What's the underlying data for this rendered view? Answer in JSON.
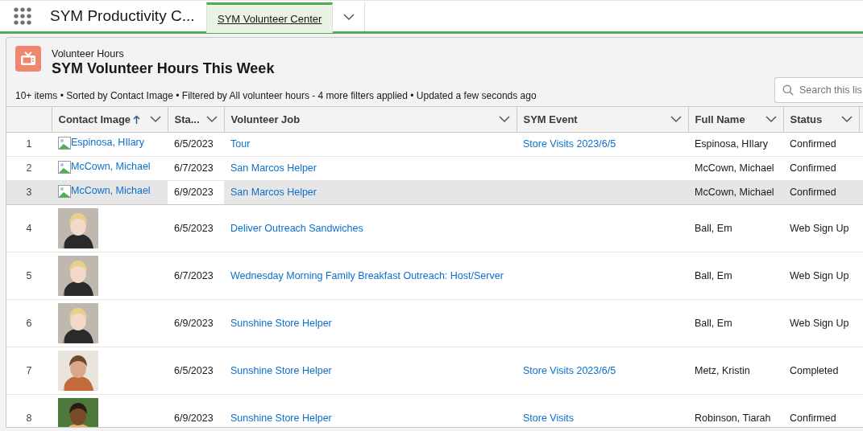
{
  "app": {
    "name": "SYM Productivity C..."
  },
  "tabs": [
    {
      "label": "SYM Volunteer Center",
      "selected": true
    }
  ],
  "list": {
    "object": "Volunteer Hours",
    "title": "SYM Volunteer Hours This Week",
    "info": "10+ items • Sorted by Contact Image • Filtered by All volunteer hours - 4 more filters applied • Updated a few seconds ago",
    "search": {
      "placeholder": "Search this lis"
    }
  },
  "columns": [
    {
      "label": "Contact Image",
      "sorted": true
    },
    {
      "label": "Sta...",
      "sorted": false
    },
    {
      "label": "Volunteer Job",
      "sorted": false
    },
    {
      "label": "SYM Event",
      "sorted": false
    },
    {
      "label": "Full Name",
      "sorted": false
    },
    {
      "label": "Status",
      "sorted": false
    }
  ],
  "rows": [
    {
      "number": "1",
      "contact": {
        "kind": "broken",
        "text": "Espinosa, HIlary"
      },
      "start": "6/5/2023",
      "job": "Tour",
      "event": "Store Visits 2023/6/5",
      "full_name": "Espinosa, HIlary",
      "status": "Confirmed",
      "selected": false
    },
    {
      "number": "2",
      "contact": {
        "kind": "broken",
        "text": "McCown, Michael"
      },
      "start": "6/7/2023",
      "job": "San Marcos Helper",
      "full_name": "McCown, Michael",
      "status": "Confirmed",
      "selected": false
    },
    {
      "number": "3",
      "contact": {
        "kind": "broken",
        "text": "McCown, Michael"
      },
      "start": "6/9/2023",
      "job": "San Marcos Helper",
      "full_name": "McCown, Michael",
      "status": "Confirmed",
      "selected": true
    },
    {
      "number": "4",
      "start": "6/5/2023",
      "job": "Deliver Outreach Sandwiches",
      "full_name": "Ball, Em",
      "status": "Web Sign Up",
      "selected": false
    },
    {
      "number": "5",
      "start": "6/7/2023",
      "job": "Wednesday Morning Family Breakfast Outreach: Host/Server",
      "full_name": "Ball, Em",
      "status": "Web Sign Up",
      "selected": false
    },
    {
      "number": "6",
      "start": "6/9/2023",
      "job": "Sunshine Store Helper",
      "full_name": "Ball, Em",
      "status": "Web Sign Up",
      "selected": false
    },
    {
      "number": "7",
      "start": "6/5/2023",
      "job": "Sunshine Store Helper",
      "event": "Store Visits 2023/6/5",
      "full_name": "Metz, Kristin",
      "status": "Completed",
      "selected": false
    },
    {
      "number": "8",
      "start": "6/9/2023",
      "job": "Sunshine Store Helper",
      "event": "Store Visits",
      "full_name": "Robinson, Tiarah",
      "status": "Confirmed",
      "selected": false
    }
  ]
}
